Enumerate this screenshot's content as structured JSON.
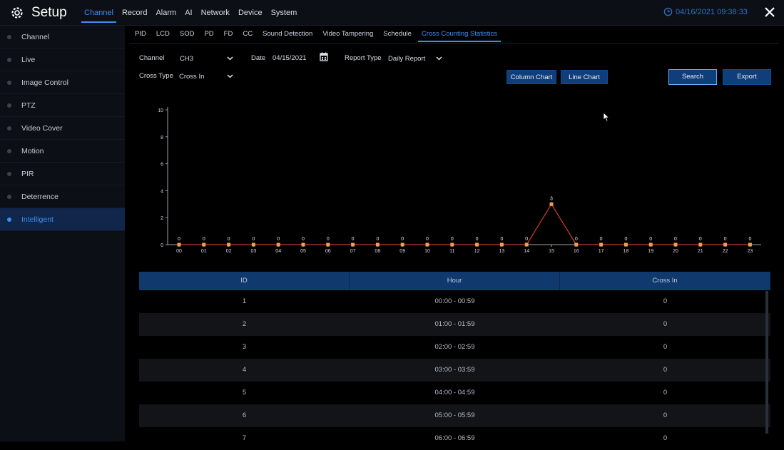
{
  "app": {
    "title": "Setup"
  },
  "main_tabs": [
    {
      "label": "Channel",
      "active": true
    },
    {
      "label": "Record",
      "active": false
    },
    {
      "label": "Alarm",
      "active": false
    },
    {
      "label": "AI",
      "active": false
    },
    {
      "label": "Network",
      "active": false
    },
    {
      "label": "Device",
      "active": false
    },
    {
      "label": "System",
      "active": false
    }
  ],
  "datetime": "04/16/2021 09:38:33",
  "sidebar": {
    "items": [
      {
        "label": "Channel",
        "active": false
      },
      {
        "label": "Live",
        "active": false
      },
      {
        "label": "Image Control",
        "active": false
      },
      {
        "label": "PTZ",
        "active": false
      },
      {
        "label": "Video Cover",
        "active": false
      },
      {
        "label": "Motion",
        "active": false
      },
      {
        "label": "PIR",
        "active": false
      },
      {
        "label": "Deterrence",
        "active": false
      },
      {
        "label": "Intelligent",
        "active": true
      }
    ]
  },
  "subtabs": [
    {
      "label": "PID",
      "active": false
    },
    {
      "label": "LCD",
      "active": false
    },
    {
      "label": "SOD",
      "active": false
    },
    {
      "label": "PD",
      "active": false
    },
    {
      "label": "FD",
      "active": false
    },
    {
      "label": "CC",
      "active": false
    },
    {
      "label": "Sound Detection",
      "active": false
    },
    {
      "label": "Video Tampering",
      "active": false
    },
    {
      "label": "Schedule",
      "active": false
    },
    {
      "label": "Cross Counting Statistics",
      "active": true
    }
  ],
  "filters": {
    "channel_label": "Channel",
    "channel_value": "CH3",
    "date_label": "Date",
    "date_value": "04/15/2021",
    "report_type_label": "Report Type",
    "report_type_value": "Daily Report",
    "cross_type_label": "Cross Type",
    "cross_type_value": "Cross In"
  },
  "buttons": {
    "column_chart": "Column Chart",
    "line_chart": "Line Chart",
    "search": "Search",
    "export": "Export"
  },
  "colors": {
    "accent": "#3d8ef0",
    "button_bg": "#103e7a",
    "line": "#c0392b",
    "marker": "#f0a050"
  },
  "chart_data": {
    "type": "line",
    "categories": [
      "00",
      "01",
      "02",
      "03",
      "04",
      "05",
      "06",
      "07",
      "08",
      "09",
      "10",
      "11",
      "12",
      "13",
      "14",
      "15",
      "16",
      "17",
      "18",
      "19",
      "20",
      "21",
      "22",
      "23"
    ],
    "series": [
      {
        "values": [
          0,
          0,
          0,
          0,
          0,
          0,
          0,
          0,
          0,
          0,
          0,
          0,
          0,
          0,
          0,
          3,
          0,
          0,
          0,
          0,
          0,
          0,
          0,
          0
        ]
      }
    ],
    "ylim": [
      0,
      10
    ],
    "yticks": [
      0,
      2,
      4,
      6,
      8,
      10
    ],
    "xlabel": "",
    "ylabel": "",
    "title": ""
  },
  "table": {
    "headers": [
      "ID",
      "Hour",
      "Cross In"
    ],
    "rows": [
      [
        "1",
        "00:00 - 00:59",
        "0"
      ],
      [
        "2",
        "01:00 - 01:59",
        "0"
      ],
      [
        "3",
        "02:00 - 02:59",
        "0"
      ],
      [
        "4",
        "03:00 - 03:59",
        "0"
      ],
      [
        "5",
        "04:00 - 04:59",
        "0"
      ],
      [
        "6",
        "05:00 - 05:59",
        "0"
      ],
      [
        "7",
        "06:00 - 06:59",
        "0"
      ]
    ]
  }
}
